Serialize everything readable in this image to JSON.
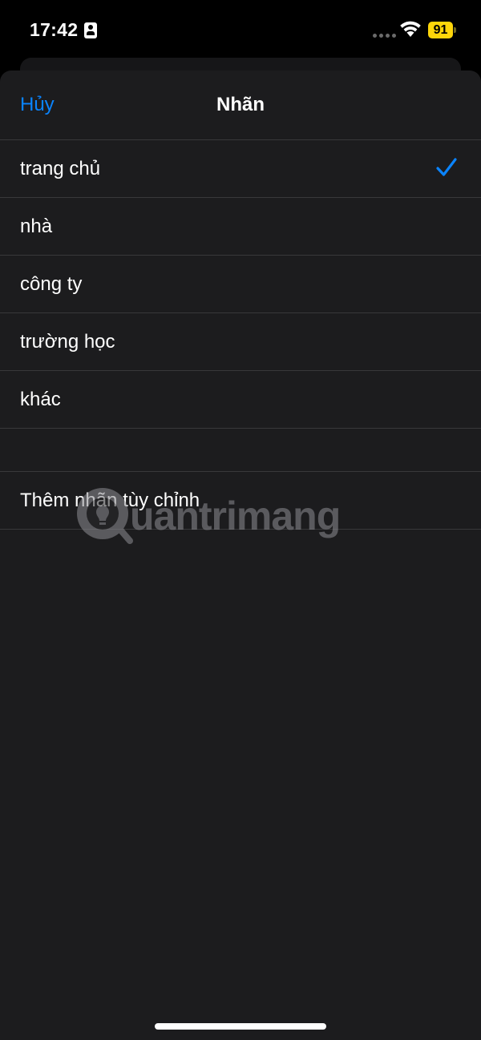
{
  "status_bar": {
    "time": "17:42",
    "battery_level": "91",
    "icons": [
      "contact-card-icon",
      "cellular-dots-icon",
      "wifi-icon",
      "battery-icon"
    ],
    "battery_color": "#ffd60a"
  },
  "nav": {
    "cancel_label": "Hủy",
    "title": "Nhãn"
  },
  "labels": [
    {
      "label": "trang chủ",
      "selected": true
    },
    {
      "label": "nhà",
      "selected": false
    },
    {
      "label": "công ty",
      "selected": false
    },
    {
      "label": "trường học",
      "selected": false
    },
    {
      "label": "khác",
      "selected": false
    }
  ],
  "custom_label_button": "Thêm nhãn tùy chỉnh",
  "watermark": {
    "text": "uantrimang",
    "icon": "lightbulb-logo-icon"
  },
  "colors": {
    "accent": "#0a84ff",
    "sheet_background": "#1c1c1e",
    "separator": "#38383a"
  }
}
